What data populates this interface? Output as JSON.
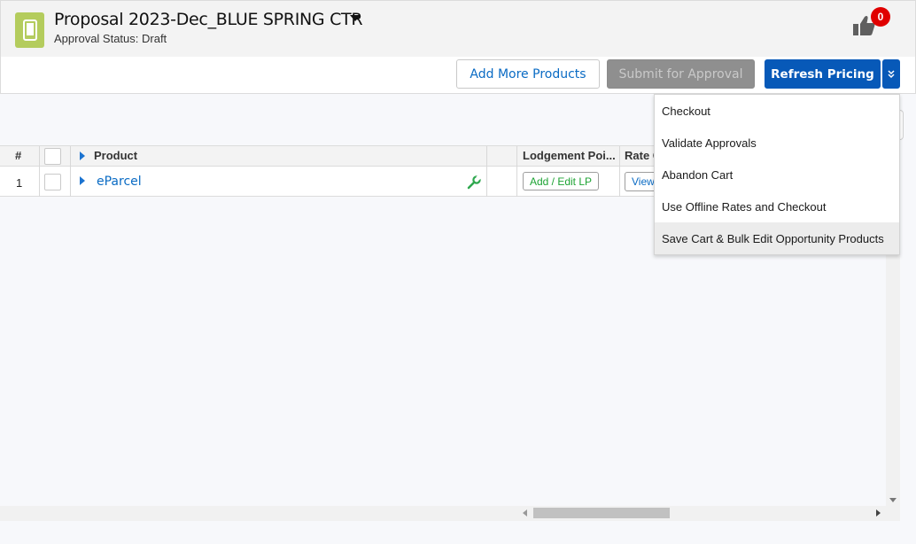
{
  "header": {
    "title": "Proposal 2023-Dec_BLUE SPRING CTR",
    "approval_status": "Approval Status: Draft",
    "notification_count": "0",
    "icons": {
      "app": "mobile-device-icon",
      "menu": "caret-down-icon",
      "thumb": "thumbs-up-icon"
    },
    "colors": {
      "app_icon_bg": "#b4cc5d",
      "badge": "#e00000"
    }
  },
  "toolbar": {
    "add_products_label": "Add More Products",
    "submit_label": "Submit for Approval",
    "refresh_label": "Refresh Pricing",
    "colors": {
      "primary": "#0759b8",
      "disabled": "#8f8f8f"
    }
  },
  "dropdown": {
    "items": [
      {
        "label": "Checkout"
      },
      {
        "label": "Validate Approvals"
      },
      {
        "label": "Abandon Cart"
      },
      {
        "label": "Use Offline Rates and Checkout"
      },
      {
        "label": "Save Cart & Bulk Edit Opportunity Products"
      }
    ],
    "highlighted_index": 4
  },
  "grid": {
    "columns": [
      "#",
      "",
      "Product",
      "",
      "Lodgement Poi...",
      "Rate C"
    ],
    "rows": [
      {
        "num": "1",
        "product": "eParcel",
        "lp_button": "Add / Edit LP",
        "view_button": "View"
      }
    ],
    "icons": {
      "config": "wrench-icon",
      "expand": "expand-triangle-icon"
    },
    "colors": {
      "link": "#0a6bc4",
      "lp_text": "#1da333"
    }
  }
}
